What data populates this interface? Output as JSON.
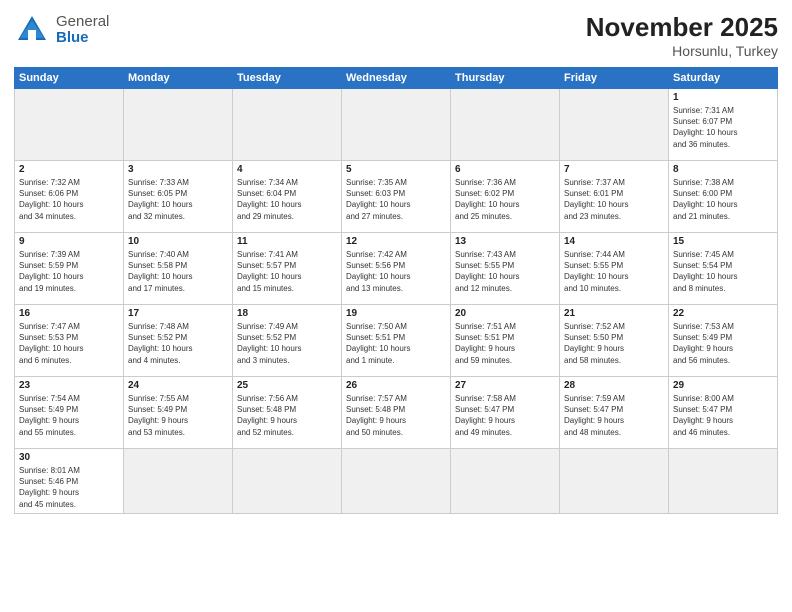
{
  "header": {
    "logo_general": "General",
    "logo_blue": "Blue",
    "month": "November 2025",
    "location": "Horsunlu, Turkey"
  },
  "days_of_week": [
    "Sunday",
    "Monday",
    "Tuesday",
    "Wednesday",
    "Thursday",
    "Friday",
    "Saturday"
  ],
  "weeks": [
    [
      {
        "day": "",
        "info": ""
      },
      {
        "day": "",
        "info": ""
      },
      {
        "day": "",
        "info": ""
      },
      {
        "day": "",
        "info": ""
      },
      {
        "day": "",
        "info": ""
      },
      {
        "day": "",
        "info": ""
      },
      {
        "day": "1",
        "info": "Sunrise: 7:31 AM\nSunset: 6:07 PM\nDaylight: 10 hours\nand 36 minutes."
      }
    ],
    [
      {
        "day": "2",
        "info": "Sunrise: 7:32 AM\nSunset: 6:06 PM\nDaylight: 10 hours\nand 34 minutes."
      },
      {
        "day": "3",
        "info": "Sunrise: 7:33 AM\nSunset: 6:05 PM\nDaylight: 10 hours\nand 32 minutes."
      },
      {
        "day": "4",
        "info": "Sunrise: 7:34 AM\nSunset: 6:04 PM\nDaylight: 10 hours\nand 29 minutes."
      },
      {
        "day": "5",
        "info": "Sunrise: 7:35 AM\nSunset: 6:03 PM\nDaylight: 10 hours\nand 27 minutes."
      },
      {
        "day": "6",
        "info": "Sunrise: 7:36 AM\nSunset: 6:02 PM\nDaylight: 10 hours\nand 25 minutes."
      },
      {
        "day": "7",
        "info": "Sunrise: 7:37 AM\nSunset: 6:01 PM\nDaylight: 10 hours\nand 23 minutes."
      },
      {
        "day": "8",
        "info": "Sunrise: 7:38 AM\nSunset: 6:00 PM\nDaylight: 10 hours\nand 21 minutes."
      }
    ],
    [
      {
        "day": "9",
        "info": "Sunrise: 7:39 AM\nSunset: 5:59 PM\nDaylight: 10 hours\nand 19 minutes."
      },
      {
        "day": "10",
        "info": "Sunrise: 7:40 AM\nSunset: 5:58 PM\nDaylight: 10 hours\nand 17 minutes."
      },
      {
        "day": "11",
        "info": "Sunrise: 7:41 AM\nSunset: 5:57 PM\nDaylight: 10 hours\nand 15 minutes."
      },
      {
        "day": "12",
        "info": "Sunrise: 7:42 AM\nSunset: 5:56 PM\nDaylight: 10 hours\nand 13 minutes."
      },
      {
        "day": "13",
        "info": "Sunrise: 7:43 AM\nSunset: 5:55 PM\nDaylight: 10 hours\nand 12 minutes."
      },
      {
        "day": "14",
        "info": "Sunrise: 7:44 AM\nSunset: 5:55 PM\nDaylight: 10 hours\nand 10 minutes."
      },
      {
        "day": "15",
        "info": "Sunrise: 7:45 AM\nSunset: 5:54 PM\nDaylight: 10 hours\nand 8 minutes."
      }
    ],
    [
      {
        "day": "16",
        "info": "Sunrise: 7:47 AM\nSunset: 5:53 PM\nDaylight: 10 hours\nand 6 minutes."
      },
      {
        "day": "17",
        "info": "Sunrise: 7:48 AM\nSunset: 5:52 PM\nDaylight: 10 hours\nand 4 minutes."
      },
      {
        "day": "18",
        "info": "Sunrise: 7:49 AM\nSunset: 5:52 PM\nDaylight: 10 hours\nand 3 minutes."
      },
      {
        "day": "19",
        "info": "Sunrise: 7:50 AM\nSunset: 5:51 PM\nDaylight: 10 hours\nand 1 minute."
      },
      {
        "day": "20",
        "info": "Sunrise: 7:51 AM\nSunset: 5:51 PM\nDaylight: 9 hours\nand 59 minutes."
      },
      {
        "day": "21",
        "info": "Sunrise: 7:52 AM\nSunset: 5:50 PM\nDaylight: 9 hours\nand 58 minutes."
      },
      {
        "day": "22",
        "info": "Sunrise: 7:53 AM\nSunset: 5:49 PM\nDaylight: 9 hours\nand 56 minutes."
      }
    ],
    [
      {
        "day": "23",
        "info": "Sunrise: 7:54 AM\nSunset: 5:49 PM\nDaylight: 9 hours\nand 55 minutes."
      },
      {
        "day": "24",
        "info": "Sunrise: 7:55 AM\nSunset: 5:49 PM\nDaylight: 9 hours\nand 53 minutes."
      },
      {
        "day": "25",
        "info": "Sunrise: 7:56 AM\nSunset: 5:48 PM\nDaylight: 9 hours\nand 52 minutes."
      },
      {
        "day": "26",
        "info": "Sunrise: 7:57 AM\nSunset: 5:48 PM\nDaylight: 9 hours\nand 50 minutes."
      },
      {
        "day": "27",
        "info": "Sunrise: 7:58 AM\nSunset: 5:47 PM\nDaylight: 9 hours\nand 49 minutes."
      },
      {
        "day": "28",
        "info": "Sunrise: 7:59 AM\nSunset: 5:47 PM\nDaylight: 9 hours\nand 48 minutes."
      },
      {
        "day": "29",
        "info": "Sunrise: 8:00 AM\nSunset: 5:47 PM\nDaylight: 9 hours\nand 46 minutes."
      }
    ],
    [
      {
        "day": "30",
        "info": "Sunrise: 8:01 AM\nSunset: 5:46 PM\nDaylight: 9 hours\nand 45 minutes."
      },
      {
        "day": "",
        "info": ""
      },
      {
        "day": "",
        "info": ""
      },
      {
        "day": "",
        "info": ""
      },
      {
        "day": "",
        "info": ""
      },
      {
        "day": "",
        "info": ""
      },
      {
        "day": "",
        "info": ""
      }
    ]
  ]
}
